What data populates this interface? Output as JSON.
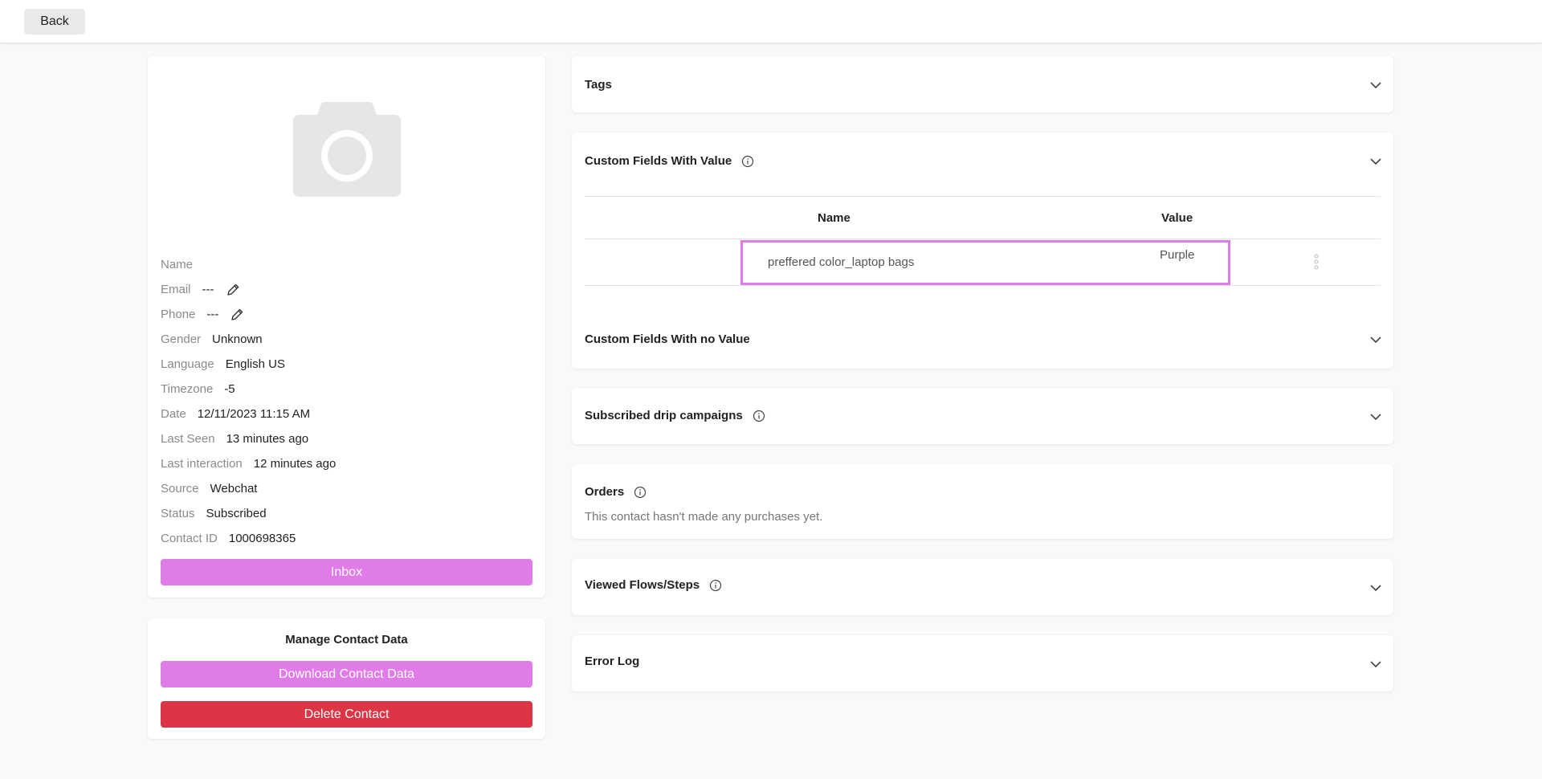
{
  "topbar": {
    "back_label": "Back"
  },
  "profile": {
    "fields": [
      {
        "label": "Name",
        "value": ""
      },
      {
        "label": "Email",
        "value": "---",
        "editable": true
      },
      {
        "label": "Phone",
        "value": "---",
        "editable": true
      },
      {
        "label": "Gender",
        "value": "Unknown"
      },
      {
        "label": "Language",
        "value": "English US"
      },
      {
        "label": "Timezone",
        "value": "-5"
      },
      {
        "label": "Date",
        "value": "12/11/2023 11:15 AM"
      },
      {
        "label": "Last Seen",
        "value": "13 minutes ago"
      },
      {
        "label": "Last interaction",
        "value": "12 minutes ago"
      },
      {
        "label": "Source",
        "value": "Webchat"
      },
      {
        "label": "Status",
        "value": "Subscribed"
      },
      {
        "label": "Contact ID",
        "value": "1000698365"
      }
    ],
    "inbox_label": "Inbox"
  },
  "manage": {
    "title": "Manage Contact Data",
    "download_label": "Download Contact Data",
    "delete_label": "Delete Contact"
  },
  "sections": {
    "tags": {
      "title": "Tags"
    },
    "custom_with_value": {
      "title": "Custom Fields With Value",
      "headers": {
        "name": "Name",
        "value": "Value"
      },
      "rows": [
        {
          "name": "preffered color_laptop bags",
          "value": "Purple"
        }
      ]
    },
    "custom_no_value": {
      "title": "Custom Fields With no Value"
    },
    "drip": {
      "title": "Subscribed drip campaigns"
    },
    "orders": {
      "title": "Orders",
      "empty_text": "This contact hasn't made any purchases yet."
    },
    "flows": {
      "title": "Viewed Flows/Steps"
    },
    "error_log": {
      "title": "Error Log"
    }
  },
  "colors": {
    "accent": "#e07ce8",
    "danger": "#dc3545",
    "background": "#f8f9fa"
  },
  "icons": {
    "photo": "camera-placeholder-icon",
    "edit": "pencil-icon",
    "info": "info-circle-icon",
    "expand": "chevron-down-icon",
    "more": "vertical-dots-icon"
  }
}
